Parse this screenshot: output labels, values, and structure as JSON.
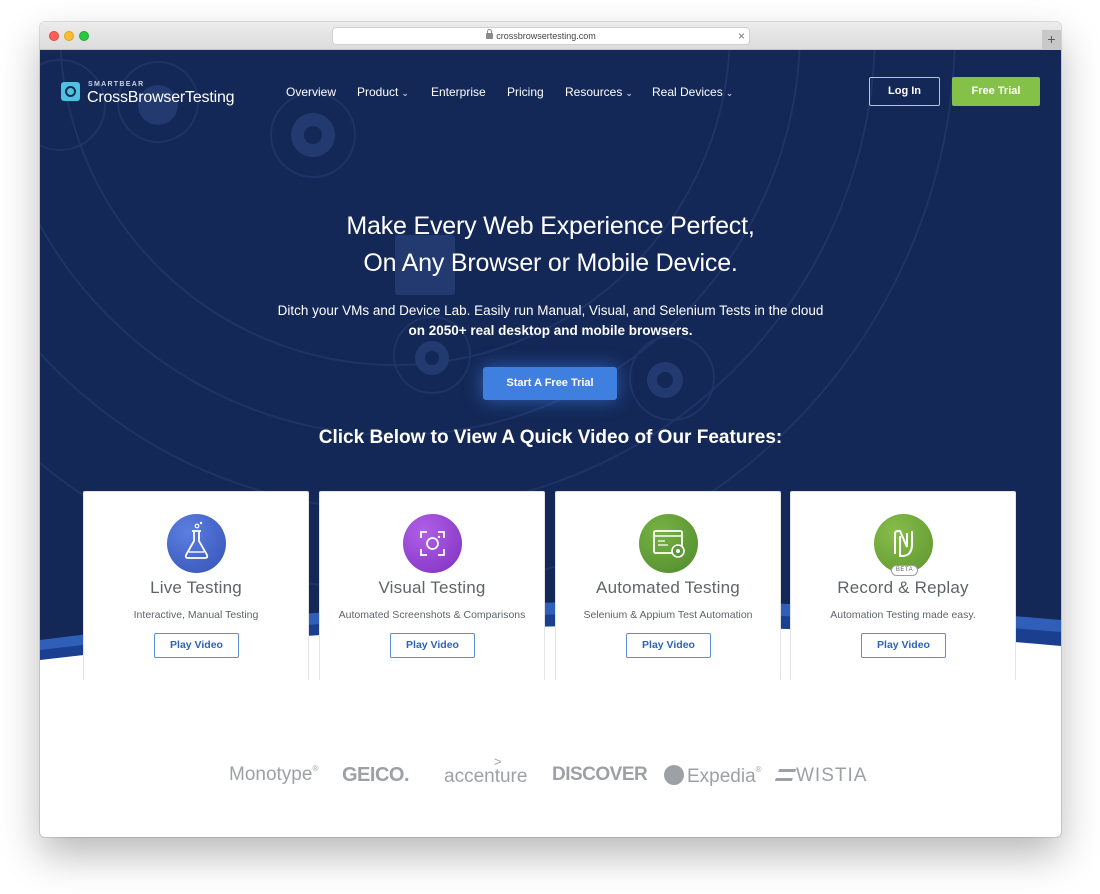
{
  "browser": {
    "url": "crossbrowsertesting.com",
    "new_tab_glyph": "+",
    "close_glyph": "×"
  },
  "brand": {
    "company": "SMARTBEAR",
    "product": "CrossBrowserTesting",
    "accent": "#4ec3e0",
    "hero_bg": "#142857",
    "cta_color": "#3f7fe0",
    "trial_color": "#84c148"
  },
  "nav": {
    "items": [
      {
        "label": "Overview",
        "dropdown": false
      },
      {
        "label": "Product",
        "dropdown": true
      },
      {
        "label": "Enterprise",
        "dropdown": false
      },
      {
        "label": "Pricing",
        "dropdown": false
      },
      {
        "label": "Resources",
        "dropdown": true
      },
      {
        "label": "Real Devices",
        "dropdown": true
      }
    ],
    "chevron": "⌄",
    "login": "Log In",
    "free_trial": "Free Trial"
  },
  "hero": {
    "headline_line1": "Make Every Web Experience Perfect,",
    "headline_line2": "On Any Browser or Mobile Device.",
    "subline": "Ditch your VMs and Device Lab. Easily run Manual, Visual, and Selenium Tests in the cloud",
    "subline_bold": "on 2050+ real desktop and mobile browsers.",
    "cta": "Start A Free Trial",
    "features_title": "Click Below to View A Quick Video of Our Features:"
  },
  "features": [
    {
      "title": "Live Testing",
      "desc": "Interactive, Manual Testing",
      "button": "Play Video",
      "icon": "flask-icon",
      "color": "#3d5fc4"
    },
    {
      "title": "Visual Testing",
      "desc": "Automated Screenshots & Comparisons",
      "button": "Play Video",
      "icon": "camera-frame-icon",
      "color": "#8e3cc9"
    },
    {
      "title": "Automated Testing",
      "desc": "Selenium & Appium Test Automation",
      "button": "Play Video",
      "icon": "browser-gear-icon",
      "color": "#5c9a35"
    },
    {
      "title": "Record & Replay",
      "desc": "Automation Testing made easy.",
      "button": "Play Video",
      "icon": "record-replay-icon",
      "color": "#6fa83a",
      "badge": "BETA"
    }
  ],
  "clients": [
    {
      "name": "Monotype",
      "mark": "®"
    },
    {
      "name": "GEICO",
      "mark": "."
    },
    {
      "name": "accenture",
      "mark": ">"
    },
    {
      "name": "DISCOVER",
      "mark": ""
    },
    {
      "name": "Expedia",
      "mark": "®"
    },
    {
      "name": "WISTIA",
      "mark": ""
    }
  ]
}
